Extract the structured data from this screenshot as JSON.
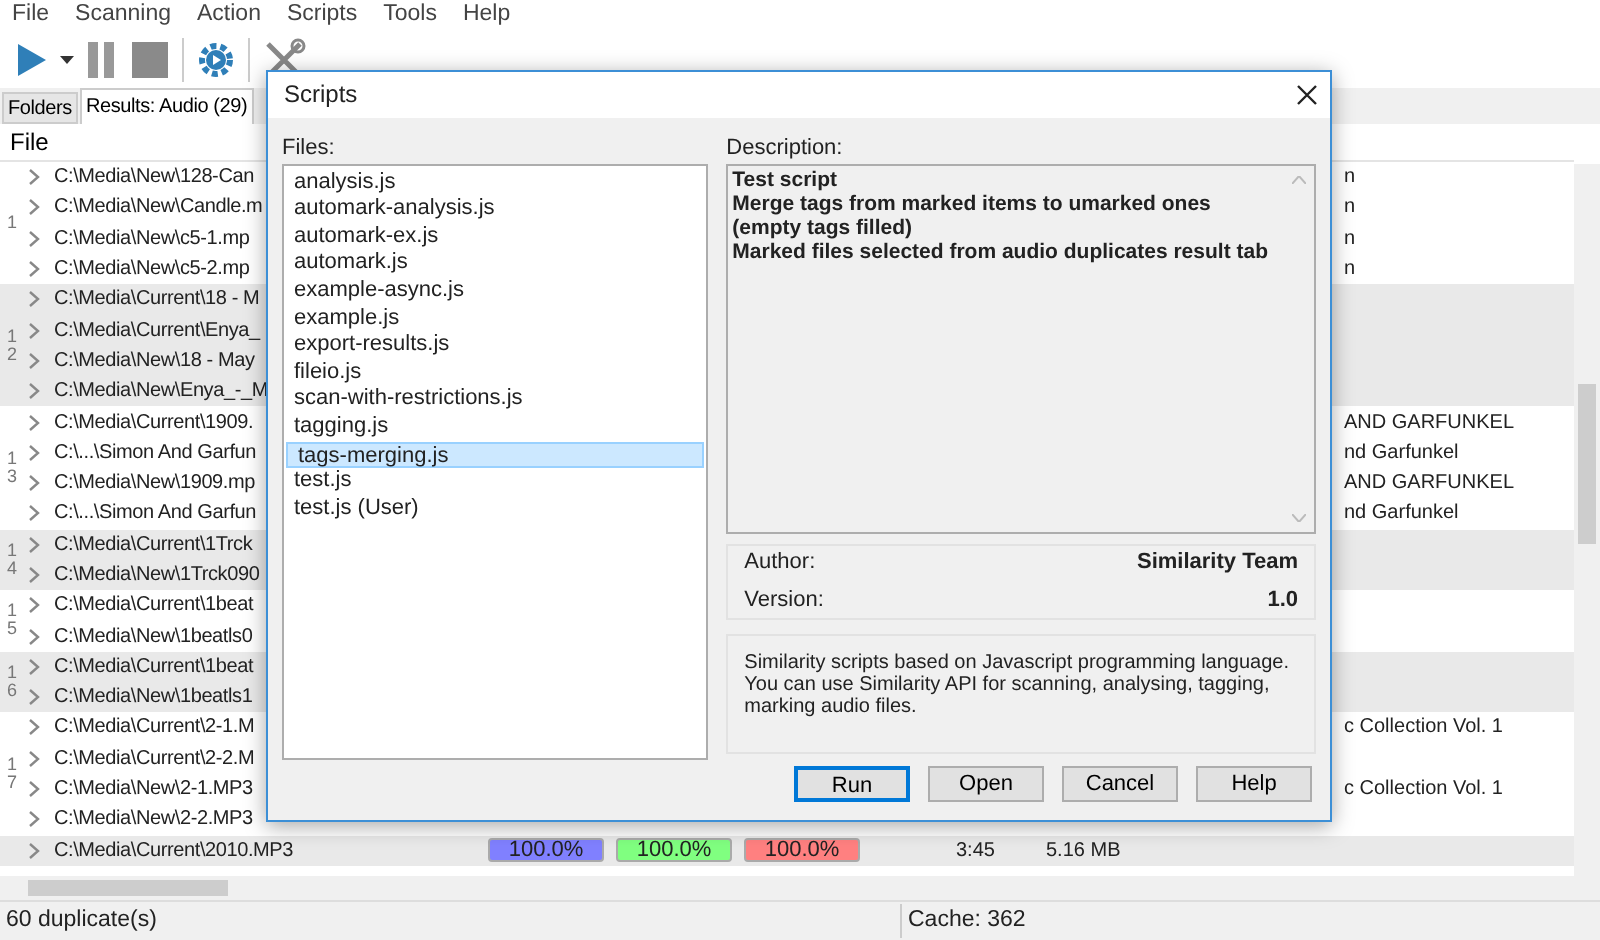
{
  "menu": [
    "File",
    "Scanning",
    "Action",
    "Scripts",
    "Tools",
    "Help"
  ],
  "tabs": [
    {
      "label": "Folders",
      "selected": false
    },
    {
      "label": "Results: Audio (29)",
      "selected": true
    }
  ],
  "column_header": "File",
  "groups": [
    {
      "label": "1",
      "shaded": false,
      "rows": [
        {
          "path": "C:\\Media\\New\\128-Can",
          "right_text": "n"
        },
        {
          "path": "C:\\Media\\New\\Candle.m",
          "right_text": "n"
        },
        {
          "path": "C:\\Media\\New\\c5-1.mp",
          "right_text": "n"
        },
        {
          "path": "C:\\Media\\New\\c5-2.mp",
          "right_text": "n"
        }
      ]
    },
    {
      "label": "12",
      "shaded": true,
      "rows": [
        {
          "path": "C:\\Media\\Current\\18 - M"
        },
        {
          "path": "C:\\Media\\Current\\Enya_"
        },
        {
          "path": "C:\\Media\\New\\18 - May"
        },
        {
          "path": "C:\\Media\\New\\Enya_-_M"
        }
      ]
    },
    {
      "label": "13",
      "shaded": false,
      "rows": [
        {
          "path": "C:\\Media\\Current\\1909.",
          "right_text": "AND GARFUNKEL"
        },
        {
          "path": "C:\\...\\Simon And Garfun",
          "right_text": "nd Garfunkel"
        },
        {
          "path": "C:\\Media\\New\\1909.mp",
          "right_text": "AND GARFUNKEL"
        },
        {
          "path": "C:\\...\\Simon And Garfun",
          "right_text": "nd Garfunkel"
        }
      ]
    },
    {
      "label": "14",
      "shaded": true,
      "rows": [
        {
          "path": "C:\\Media\\Current\\1Trck"
        },
        {
          "path": "C:\\Media\\New\\1Trck090"
        }
      ]
    },
    {
      "label": "15",
      "shaded": false,
      "rows": [
        {
          "path": "C:\\Media\\Current\\1beat"
        },
        {
          "path": "C:\\Media\\New\\1beatls0"
        }
      ]
    },
    {
      "label": "16",
      "shaded": true,
      "rows": [
        {
          "path": "C:\\Media\\Current\\1beat"
        },
        {
          "path": "C:\\Media\\New\\1beatls1"
        }
      ]
    },
    {
      "label": "17",
      "shaded": false,
      "rows": [
        {
          "path": "C:\\Media\\Current\\2-1.M",
          "right_text": "c Collection Vol. 1"
        },
        {
          "path": "C:\\Media\\Current\\2-2.M"
        },
        {
          "path": "C:\\Media\\New\\2-1.MP3",
          "right_text": "c Collection Vol. 1"
        },
        {
          "path": "C:\\Media\\New\\2-2.MP3"
        }
      ]
    },
    {
      "shaded": true,
      "rows": [
        {
          "path": "C:\\Media\\Current\\2010.MP3",
          "similarity": [
            {
              "text": "100.0%",
              "color": "#8080ff"
            },
            {
              "text": "100.0%",
              "color": "#80ff80"
            },
            {
              "text": "100.0%",
              "color": "#ff8080"
            }
          ],
          "duration": "3:45",
          "size": "5.16 MB"
        }
      ]
    }
  ],
  "status_bar": [
    "60 duplicate(s)",
    "Cache: 362"
  ],
  "dialog": {
    "title": "Scripts",
    "files_label": "Files:",
    "files": [
      {
        "name": "analysis.js",
        "selected": false
      },
      {
        "name": "automark-analysis.js",
        "selected": false
      },
      {
        "name": "automark-ex.js",
        "selected": false
      },
      {
        "name": "automark.js",
        "selected": false
      },
      {
        "name": "example-async.js",
        "selected": false
      },
      {
        "name": "example.js",
        "selected": false
      },
      {
        "name": "export-results.js",
        "selected": false
      },
      {
        "name": "fileio.js",
        "selected": false
      },
      {
        "name": "scan-with-restrictions.js",
        "selected": false
      },
      {
        "name": "tagging.js",
        "selected": false
      },
      {
        "name": "tags-merging.js",
        "selected": true
      },
      {
        "name": "test.js",
        "selected": false
      },
      {
        "name": "test.js (User)",
        "selected": false
      }
    ],
    "description_label": "Description:",
    "description": [
      "Test script",
      "Merge tags from marked items to umarked ones (empty tags filled)",
      "Marked files selected from audio duplicates result tab"
    ],
    "author_label": "Author:",
    "author": "Similarity Team",
    "version_label": "Version:",
    "version": "1.0",
    "info": "Similarity scripts based on Javascript programming language. You can use Similarity API for scanning, analysing, tagging, marking audio files.",
    "buttons": [
      {
        "label": "Run",
        "default": true
      },
      {
        "label": "Open",
        "default": false
      },
      {
        "label": "Cancel",
        "default": false
      },
      {
        "label": "Help",
        "default": false
      }
    ]
  }
}
